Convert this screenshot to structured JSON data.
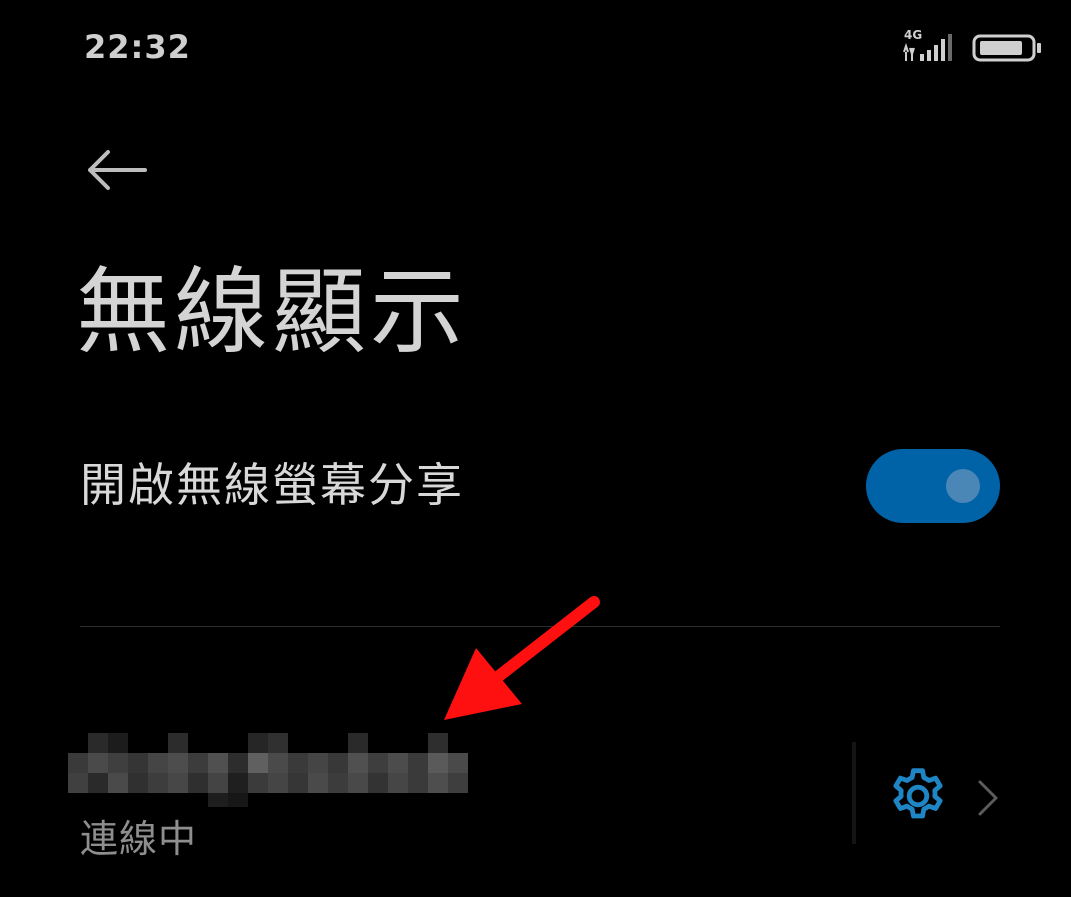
{
  "status_bar": {
    "time": "22:32",
    "network": "4G",
    "icons": [
      "signal-bars-icon",
      "battery-icon"
    ]
  },
  "header": {
    "back_icon": "back-arrow-icon",
    "title": "無線顯示"
  },
  "settings": {
    "wireless_share": {
      "label": "開啟無線螢幕分享",
      "enabled": true
    }
  },
  "devices": [
    {
      "name_redacted": true,
      "status": "連線中",
      "icons": [
        "gear-icon",
        "chevron-right-icon"
      ]
    }
  ],
  "colors": {
    "background": "#000000",
    "toggle_on": "#0063a8",
    "accent": "#1f86c6",
    "annotation_arrow": "#ff1010"
  }
}
